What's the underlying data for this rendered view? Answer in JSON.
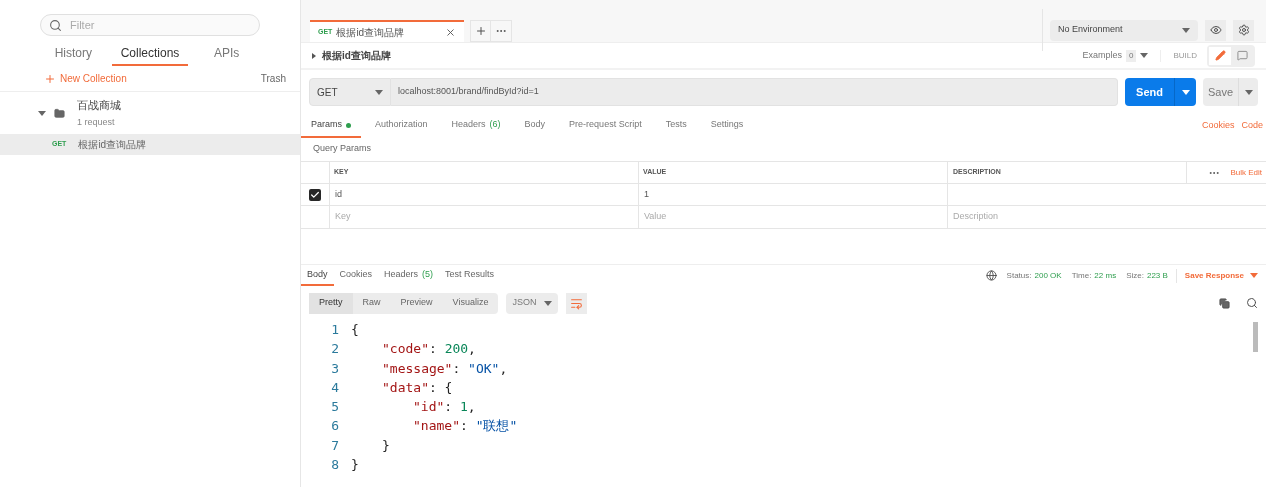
{
  "sidebar": {
    "filter": {
      "placeholder": "Filter"
    },
    "tabs": [
      {
        "label": "History",
        "selected": false
      },
      {
        "label": "Collections",
        "selected": true
      },
      {
        "label": "APIs",
        "selected": false
      }
    ],
    "new_collection": "New Collection",
    "trash": "Trash",
    "collections": [
      {
        "name": "百战商城",
        "count": "1 request",
        "expanded": true,
        "children": [
          {
            "method": "GET",
            "name": "根据id查询品牌",
            "selected": true
          }
        ]
      }
    ]
  },
  "request_tabs": [
    {
      "method": "GET",
      "name": "根据id查询品牌",
      "selected": true
    }
  ],
  "environment": "No Environment",
  "request": {
    "title": "根据id查询品牌",
    "examples_label": "Examples",
    "examples_count": "0",
    "build": "BUILD",
    "method": "GET",
    "url": "localhost:8001/brand/findById?id=1",
    "send": "Send",
    "save": "Save"
  },
  "request_sections": [
    {
      "label": "Params",
      "dot": true,
      "selected": true
    },
    {
      "label": "Authorization",
      "dot": false,
      "selected": false
    },
    {
      "label": "Headers",
      "count": "(6)",
      "dot": false,
      "selected": false
    },
    {
      "label": "Body",
      "dot": false,
      "selected": false
    },
    {
      "label": "Pre-request Script",
      "dot": false,
      "selected": false
    },
    {
      "label": "Tests",
      "dot": false,
      "selected": false
    },
    {
      "label": "Settings",
      "dot": false,
      "selected": false
    }
  ],
  "cookies": "Cookies",
  "code": "Code",
  "query_params": {
    "title": "Query Params",
    "columns": [
      "KEY",
      "VALUE",
      "DESCRIPTION"
    ],
    "bulk_edit": "Bulk Edit",
    "rows": [
      {
        "key": "id",
        "value": "1",
        "checked": true
      }
    ],
    "new_row": {
      "key": {
        "placeholder": "Key"
      },
      "value": {
        "placeholder": "Value"
      },
      "description": {
        "placeholder": "Description"
      }
    }
  },
  "response_tabs": [
    {
      "label": "Body",
      "selected": true
    },
    {
      "label": "Cookies",
      "selected": false
    },
    {
      "label": "Headers",
      "count": "(5)",
      "selected": false
    },
    {
      "label": "Test Results",
      "selected": false
    }
  ],
  "status": {
    "status_label": "Status:",
    "status": "200 OK",
    "time_label": "Time:",
    "time": "22 ms",
    "size_label": "Size:",
    "size": "223 B",
    "save_response": "Save Response"
  },
  "view_modes": [
    {
      "label": "Pretty",
      "selected": true
    },
    {
      "label": "Raw",
      "selected": false
    },
    {
      "label": "Preview",
      "selected": false
    },
    {
      "label": "Visualize",
      "selected": false
    }
  ],
  "format": "JSON",
  "code_lines": [
    {
      "number": "1",
      "tokens": [
        {
          "text": "{",
          "kind": "punct"
        }
      ]
    },
    {
      "number": "2",
      "tokens": [
        {
          "text": "\"code\"",
          "kind": "key"
        },
        {
          "text": ": ",
          "kind": "punct"
        },
        {
          "text": "200",
          "kind": "number"
        },
        {
          "text": ",",
          "kind": "punct"
        }
      ]
    },
    {
      "number": "3",
      "tokens": [
        {
          "text": "\"message\"",
          "kind": "key"
        },
        {
          "text": ": ",
          "kind": "punct"
        },
        {
          "text": "\"OK\"",
          "kind": "string"
        },
        {
          "text": ",",
          "kind": "punct"
        }
      ]
    },
    {
      "number": "4",
      "tokens": [
        {
          "text": "\"data\"",
          "kind": "key"
        },
        {
          "text": ": {",
          "kind": "punct"
        }
      ]
    },
    {
      "number": "5",
      "tokens": [
        {
          "text": "\"id\"",
          "kind": "key"
        },
        {
          "text": ": ",
          "kind": "punct"
        },
        {
          "text": "1",
          "kind": "number"
        },
        {
          "text": ",",
          "kind": "punct"
        }
      ]
    },
    {
      "number": "6",
      "tokens": [
        {
          "text": "\"name\"",
          "kind": "key"
        },
        {
          "text": ": ",
          "kind": "punct"
        },
        {
          "text": "\"联想\"",
          "kind": "string"
        }
      ]
    },
    {
      "number": "7",
      "tokens": [
        {
          "text": "}",
          "kind": "punct"
        }
      ]
    },
    {
      "number": "8",
      "tokens": [
        {
          "text": "}",
          "kind": "punct"
        }
      ]
    }
  ]
}
